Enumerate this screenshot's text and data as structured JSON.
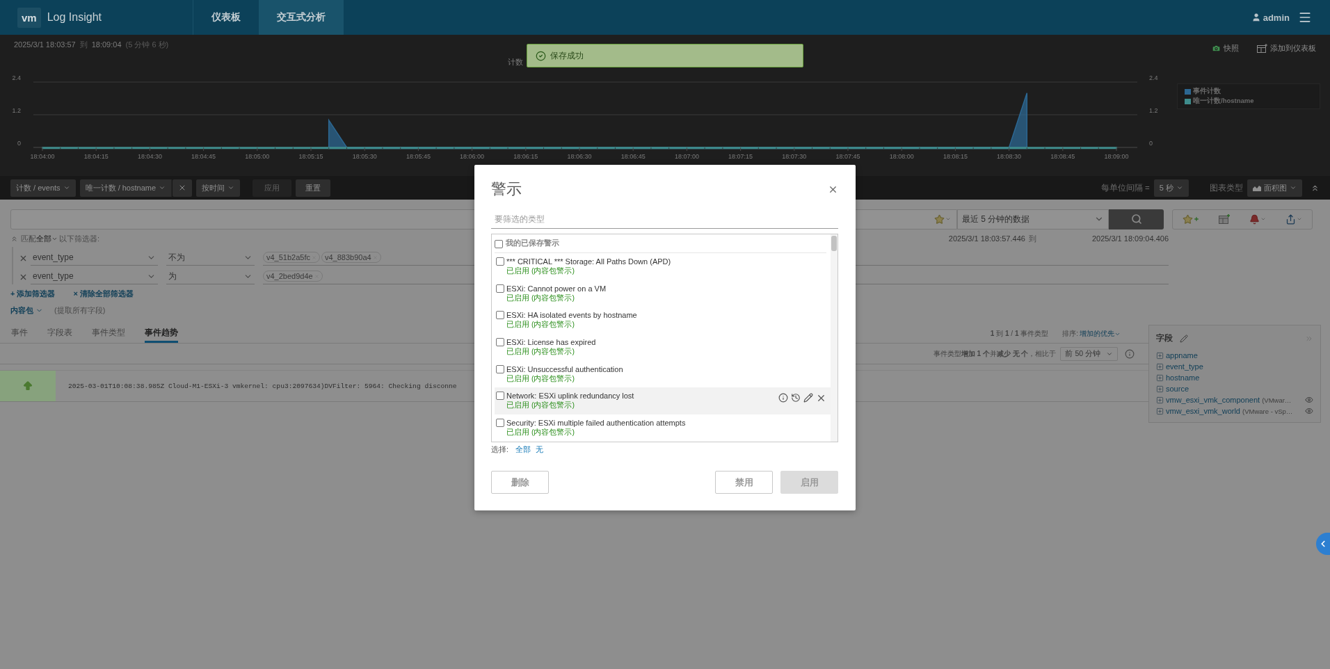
{
  "nav": {
    "logo": "vm",
    "product": "Log Insight",
    "tabs": [
      {
        "label": "仪表板",
        "selected": false
      },
      {
        "label": "交互式分析",
        "selected": true
      }
    ],
    "user": "admin"
  },
  "toast": {
    "message": "保存成功"
  },
  "chart_panel": {
    "range_from": "2025/3/1  18:03:57",
    "range_word": "到",
    "range_to": "18:09:04",
    "duration": "(5 分钟 6 秒)",
    "snapshot": "快照",
    "add_to_dashboard": "添加到仪表板",
    "chart_data": {
      "type": "area",
      "ylabel": "计数",
      "ylim": [
        0,
        2.4
      ],
      "yticks": [
        0,
        1.2,
        2.4
      ],
      "y2lim": [
        0,
        2.4
      ],
      "y2ticks": [
        0,
        1.2,
        2.4
      ],
      "categories": [
        "18:04:00",
        null,
        null,
        "18:04:15",
        null,
        null,
        "18:04:30",
        null,
        null,
        "18:04:45",
        null,
        null,
        "18:05:00",
        null,
        null,
        "18:05:15",
        null,
        null,
        "18:05:30",
        null,
        null,
        "18:05:45",
        null,
        null,
        "18:06:00",
        null,
        null,
        "18:06:15",
        null,
        null,
        "18:06:30",
        null,
        null,
        "18:06:45",
        null,
        null,
        "18:07:00",
        null,
        null,
        "18:07:15",
        null,
        null,
        "18:07:30",
        null,
        null,
        "18:07:45",
        null,
        null,
        "18:08:00",
        null,
        null,
        "18:08:15",
        null,
        null,
        "18:08:30",
        null,
        null,
        "18:08:45",
        null,
        null,
        "18:09:00"
      ],
      "series": [
        {
          "name": "事件计数",
          "color": "#2c6792",
          "values": [
            null,
            null,
            null,
            null,
            null,
            null,
            null,
            null,
            null,
            null,
            null,
            null,
            null,
            null,
            null,
            null,
            1,
            0,
            0,
            0,
            0,
            0,
            0,
            0,
            0,
            0,
            0,
            0,
            0,
            0,
            0,
            0,
            0,
            0,
            0,
            0,
            0,
            0,
            0,
            0,
            0,
            0,
            0,
            0,
            0,
            0,
            0,
            0,
            0,
            0,
            0,
            0,
            0,
            0,
            0,
            2,
            null,
            null,
            null,
            null,
            null
          ]
        },
        {
          "name": "唯一计数/hostname",
          "color": "#3e8c8c",
          "values": [
            0,
            0,
            0,
            0,
            0,
            0,
            0,
            0,
            0,
            0,
            0,
            0,
            0,
            0,
            0,
            0,
            0,
            0,
            0,
            0,
            0,
            0,
            0,
            0,
            0,
            0,
            0,
            0,
            0,
            0,
            0,
            0,
            0,
            0,
            0,
            0,
            0,
            0,
            0,
            0,
            0,
            0,
            0,
            0,
            0,
            0,
            0,
            0,
            0,
            0,
            0,
            0,
            0,
            0,
            0,
            0,
            0,
            0,
            0,
            0,
            0
          ]
        }
      ]
    }
  },
  "toolbar": {
    "measures": [
      {
        "label": "计数 / events",
        "removable": false
      },
      {
        "label": "唯一计数 / hostname",
        "removable": true
      }
    ],
    "group_by": "按时间",
    "apply": {
      "label": "应用",
      "disabled": true
    },
    "reset": "重置",
    "interval_label": "每单位间隔 =",
    "interval": "5 秒",
    "chart_type_label": "图表类型",
    "chart_type": "面积图"
  },
  "search": {
    "time_range": "最近 5 分钟的数据",
    "range_start": "2025/3/1 18:03:57.446",
    "range_word": "到",
    "range_end": "2025/3/1 18:09:04.406"
  },
  "filters": {
    "match_label": "匹配",
    "match_value": "全部",
    "match_suffix": "以下筛选器:",
    "rows": [
      {
        "field": "event_type",
        "operator": "不为",
        "values": [
          "v4_51b2a5fc",
          "v4_883b90a4"
        ]
      },
      {
        "field": "event_type",
        "operator": "为",
        "values": [
          "v4_2bed9d4e"
        ]
      }
    ],
    "add": "+ 添加筛选器",
    "clear": "× 清除全部筛选器",
    "content_pack": "内容包",
    "content_pack_note": "(提取所有字段)"
  },
  "result_tabs": [
    {
      "label": "事件",
      "selected": false
    },
    {
      "label": "字段表",
      "selected": false
    },
    {
      "label": "事件类型",
      "selected": false
    },
    {
      "label": "事件趋势",
      "selected": true
    }
  ],
  "summary": "**1** 到 **1** / **1** 事件类型",
  "sort_label": "排序:",
  "sort_value": "增加的优先",
  "trend": "事件类型**增加 1 个**并**减少 无 个**，相比于",
  "compare": "前 50 分钟",
  "events": [
    {
      "text": "2025-03-01T10:08:38.985Z Cloud-M1-ESXi-3 vmkernel: cpu3:2097634)DVFilter: 5964: Checking disconne"
    }
  ],
  "fields_panel": {
    "title": "字段",
    "items": [
      {
        "name": "appname",
        "eye": false
      },
      {
        "name": "event_type",
        "eye": false
      },
      {
        "name": "hostname",
        "eye": false
      },
      {
        "name": "source",
        "eye": false
      },
      {
        "name": "vmw_esxi_vmk_component",
        "note": "(VMwar…",
        "eye": true
      },
      {
        "name": "vmw_esxi_vmk_world",
        "note": "(VMware - vSp…",
        "eye": true
      }
    ]
  },
  "modal": {
    "title": "警示",
    "filter_placeholder": "要筛选的类型",
    "header": {
      "label": "我的已保存警示",
      "checked": false
    },
    "alerts": [
      {
        "name": "*** CRITICAL *** Storage: All Paths Down (APD)",
        "status": "已启用 (内容包警示)",
        "checked": false,
        "highlighted": false
      },
      {
        "name": "ESXi: Cannot power on a VM",
        "status": "已启用 (内容包警示)",
        "checked": false,
        "highlighted": false
      },
      {
        "name": "ESXi: HA isolated events by hostname",
        "status": "已启用 (内容包警示)",
        "checked": false,
        "highlighted": false
      },
      {
        "name": "ESXi: License has expired",
        "status": "已启用 (内容包警示)",
        "checked": false,
        "highlighted": false
      },
      {
        "name": "ESXi: Unsuccessful authentication",
        "status": "已启用 (内容包警示)",
        "checked": false,
        "highlighted": false
      },
      {
        "name": "Network: ESXi uplink redundancy lost",
        "status": "已启用 (内容包警示)",
        "checked": false,
        "highlighted": true
      },
      {
        "name": "Security: ESXi multiple failed authentication attempts",
        "status": "已启用 (内容包警示)",
        "checked": false,
        "highlighted": false
      }
    ],
    "select_label": "选择:",
    "select_all": "全部",
    "select_none": "无",
    "buttons": [
      {
        "label": "删除",
        "kind": "outline",
        "disabled": true
      },
      {
        "label": "禁用",
        "kind": "outline",
        "disabled": true
      },
      {
        "label": "启用",
        "kind": "filled",
        "disabled": true
      }
    ]
  }
}
